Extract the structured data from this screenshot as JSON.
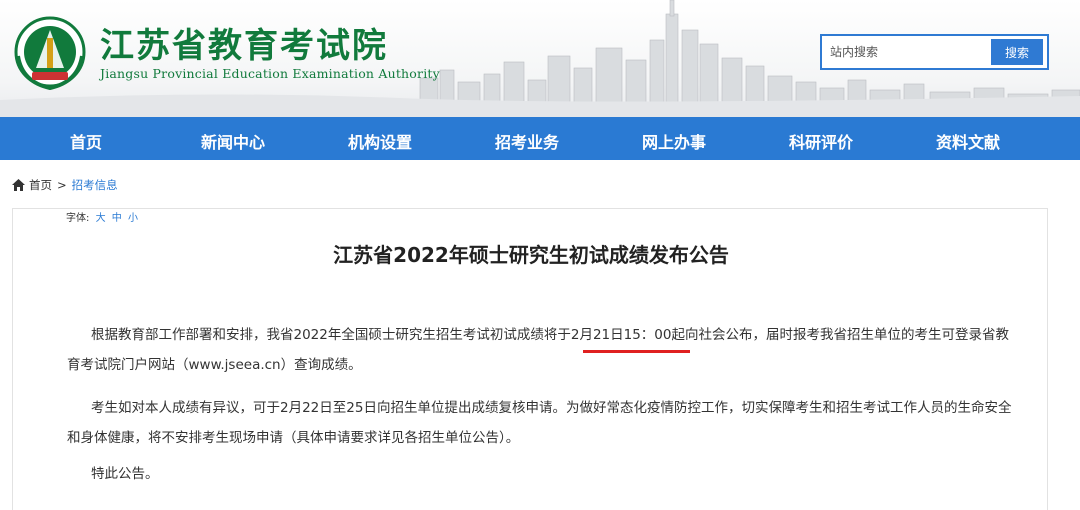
{
  "header": {
    "site_name_cn": "江苏省教育考试院",
    "site_name_en": "Jiangsu Provincial Education Examination Authority",
    "logo_icon": "emblem-icon",
    "search": {
      "placeholder": "站内搜索",
      "button_label": "搜索"
    }
  },
  "nav": {
    "items": [
      {
        "label": "首页"
      },
      {
        "label": "新闻中心"
      },
      {
        "label": "机构设置"
      },
      {
        "label": "招考业务"
      },
      {
        "label": "网上办事"
      },
      {
        "label": "科研评价"
      },
      {
        "label": "资料文献"
      }
    ]
  },
  "breadcrumb": {
    "home_label": "首页",
    "separator": ">",
    "current": "招考信息"
  },
  "article": {
    "font_size_label": "字体:",
    "font_size_options": [
      "大",
      "中",
      "小"
    ],
    "title": "江苏省2022年硕士研究生初试成绩发布公告",
    "para1_a": "根据教育部工作部署和安排，我省2022年全国硕士研究生招生考试初试成绩将于",
    "para1_highlight": "2月21日15：00",
    "para1_b": "起向社会公布，届时报考我省招生单位的考生可登录省教育考试院门户网站（www.jseea.cn）查询成绩。",
    "para2": "考生如对本人成绩有异议，可于2月22日至25日向招生单位提出成绩复核申请。为做好常态化疫情防控工作，切实保障考生和招生考试工作人员的生命安全和身体健康，将不安排考生现场申请（具体申请要求详见各招生单位公告）。",
    "para3": "特此公告。"
  },
  "colors": {
    "nav_blue": "#2a7ad3",
    "logo_green": "#117a3c",
    "underline_red": "#e02020"
  }
}
